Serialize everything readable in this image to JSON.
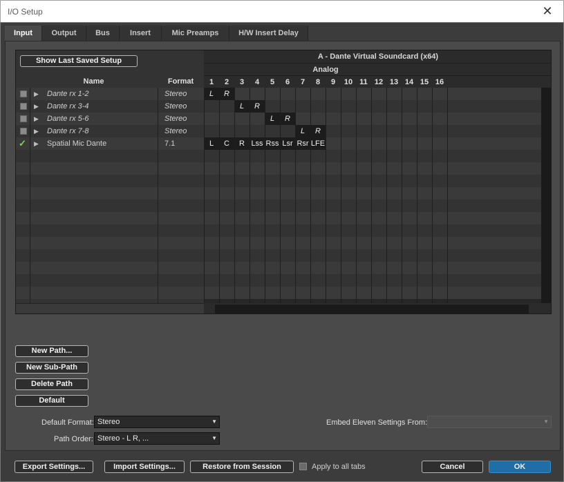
{
  "window": {
    "title": "I/O Setup",
    "close_glyph": "✕"
  },
  "tabs": [
    {
      "label": "Input",
      "active": true
    },
    {
      "label": "Output",
      "active": false
    },
    {
      "label": "Bus",
      "active": false
    },
    {
      "label": "Insert",
      "active": false
    },
    {
      "label": "Mic Preamps",
      "active": false
    },
    {
      "label": "H/W Insert Delay",
      "active": false
    }
  ],
  "grid": {
    "show_last_saved_label": "Show Last Saved Setup",
    "device_name": "A - Dante Virtual Soundcard (x64)",
    "group_name": "Analog",
    "name_header": "Name",
    "format_header": "Format",
    "channel_numbers": [
      "1",
      "2",
      "3",
      "4",
      "5",
      "6",
      "7",
      "8",
      "9",
      "10",
      "11",
      "12",
      "13",
      "14",
      "15",
      "16"
    ],
    "paths": [
      {
        "name": "Dante rx 1-2",
        "format": "Stereo",
        "enabled": false,
        "italic": true,
        "assignments": [
          "L",
          "R",
          "",
          "",
          "",
          "",
          "",
          ""
        ]
      },
      {
        "name": "Dante rx 3-4",
        "format": "Stereo",
        "enabled": false,
        "italic": true,
        "assignments": [
          "",
          "",
          "L",
          "R",
          "",
          "",
          "",
          ""
        ]
      },
      {
        "name": "Dante rx 5-6",
        "format": "Stereo",
        "enabled": false,
        "italic": true,
        "assignments": [
          "",
          "",
          "",
          "",
          "L",
          "R",
          "",
          ""
        ]
      },
      {
        "name": "Dante rx 7-8",
        "format": "Stereo",
        "enabled": false,
        "italic": true,
        "assignments": [
          "",
          "",
          "",
          "",
          "",
          "",
          "L",
          "R"
        ]
      },
      {
        "name": "Spatial Mic Dante",
        "format": "7.1",
        "enabled": true,
        "italic": false,
        "assignments": [
          "L",
          "C",
          "R",
          "Lss",
          "Rss",
          "Lsr",
          "Rsr",
          "LFE"
        ]
      }
    ],
    "check_glyph": "✓",
    "expand_glyph": "▶"
  },
  "path_buttons": {
    "new_path": "New Path...",
    "new_sub_path": "New Sub-Path",
    "delete_path": "Delete Path",
    "default": "Default"
  },
  "options": {
    "default_format_label": "Default Format:",
    "default_format_value": "Stereo",
    "path_order_label": "Path Order:",
    "path_order_value": "Stereo - L R, ...",
    "embed_label": "Embed Eleven Settings From:",
    "embed_value": "",
    "dropdown_glyph": "▼"
  },
  "footer": {
    "export": "Export Settings...",
    "import": "Import Settings...",
    "restore": "Restore from Session",
    "apply_all": "Apply to all tabs",
    "cancel": "Cancel",
    "ok": "OK"
  },
  "colors": {
    "ok_accent": "#1f6fa6",
    "check_green": "#7ed957",
    "bg": "#3c3c3c"
  }
}
